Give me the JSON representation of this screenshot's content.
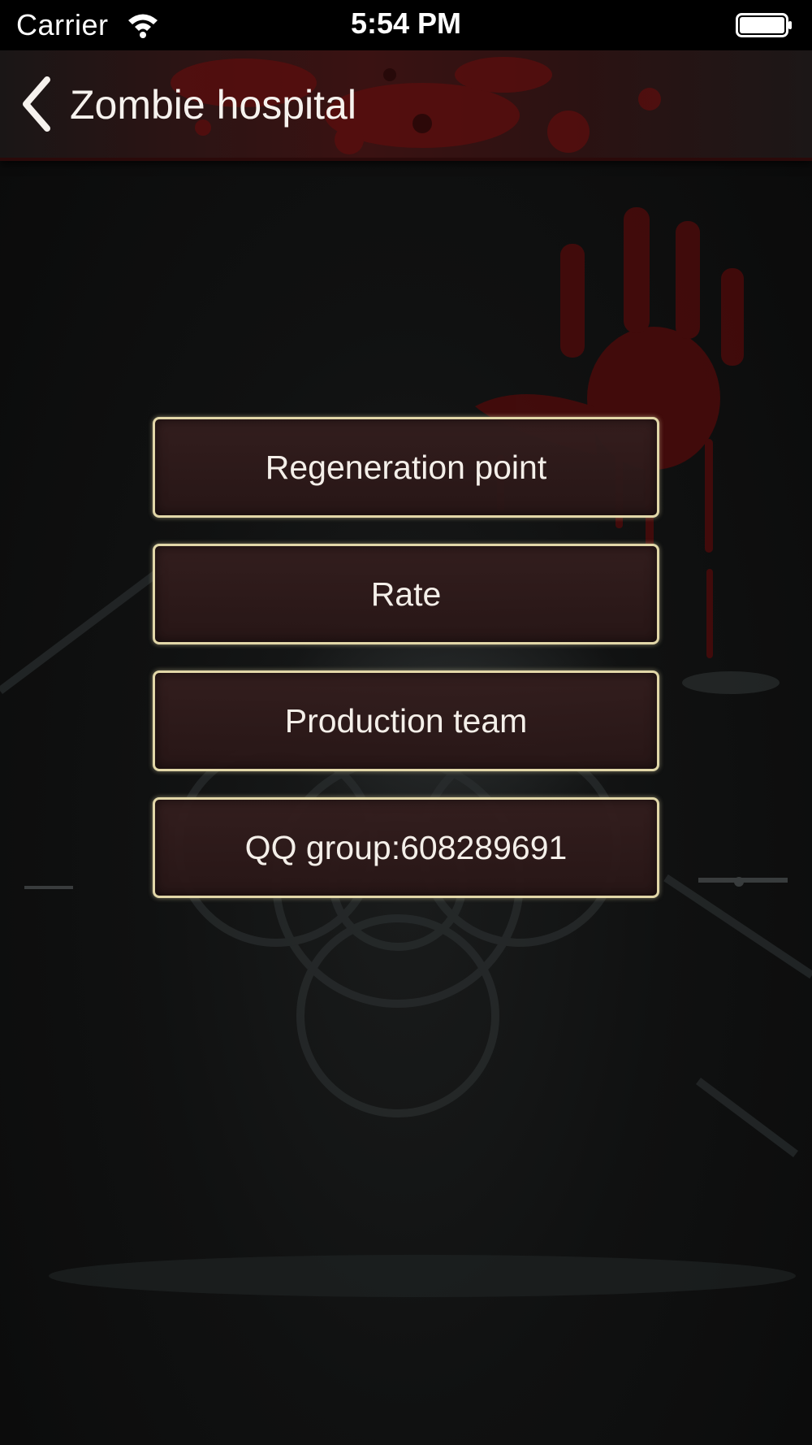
{
  "status_bar": {
    "carrier": "Carrier",
    "time": "5:54 PM",
    "wifi_icon": "wifi-icon",
    "battery_icon": "battery-icon"
  },
  "nav_bar": {
    "back_icon": "chevron-left-icon",
    "title": "Zombie hospital"
  },
  "menu": {
    "items": [
      {
        "label": "Regeneration point"
      },
      {
        "label": "Rate"
      },
      {
        "label": "Production team"
      },
      {
        "label": "QQ group:608289691"
      }
    ]
  },
  "colors": {
    "button_border": "#e2d7a8",
    "button_fill": "#2e1a1a",
    "nav_accent": "#3a1212",
    "blood": "#7a0c0c"
  }
}
